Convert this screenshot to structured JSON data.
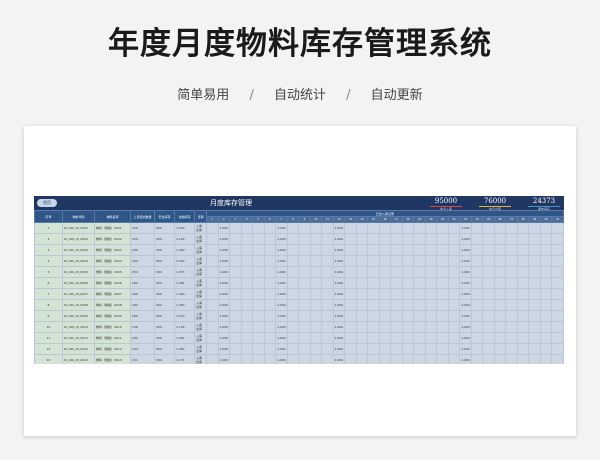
{
  "page": {
    "title": "年度月度物料库存管理系统",
    "features": [
      "简单易用",
      "自动统计",
      "自动更新"
    ],
    "separator": "/"
  },
  "sheet": {
    "home_button": "首页",
    "title": "月度库存管理",
    "stats": [
      {
        "value": "95000",
        "label": "本月入库",
        "color": "#e0443c"
      },
      {
        "value": "76000",
        "label": "本月出库",
        "color": "#e8b23a"
      },
      {
        "value": "24373",
        "label": "期末库存",
        "color": "#4a90c8"
      }
    ],
    "headers": [
      "序号",
      "物料代码",
      "物料名称",
      "上月结余数量",
      "安全库存",
      "当前库存",
      "日期"
    ],
    "daily_header": "日出入库记录",
    "io_labels": [
      "入库",
      "出库"
    ],
    "day_numbers": [
      "1",
      "2",
      "3",
      "4",
      "5",
      "6",
      "7",
      "8",
      "9",
      "10",
      "11",
      "12",
      "13",
      "14",
      "15",
      "16",
      "17",
      "18",
      "19",
      "20",
      "21",
      "22",
      "23",
      "24",
      "25",
      "26",
      "27",
      "28",
      "29",
      "30",
      "31"
    ],
    "rows": [
      {
        "no": "1",
        "code": "W_GDL_M_0001",
        "name": "物料（规格）0001",
        "prev": "150",
        "safety": "300",
        "current": "1,220"
      },
      {
        "no": "2",
        "code": "W_GDL_M_0002",
        "name": "物料（规格）0002",
        "prev": "120",
        "safety": "300",
        "current": "1,190"
      },
      {
        "no": "3",
        "code": "W_GDL_M_0003",
        "name": "物料（规格）0003",
        "prev": "190",
        "safety": "300",
        "current": "1,260"
      },
      {
        "no": "4",
        "code": "W_GDL_M_0004",
        "name": "物料（规格）0004",
        "prev": "200",
        "safety": "300",
        "current": "1,320"
      },
      {
        "no": "5",
        "code": "W_GDL_M_0005",
        "name": "物料（规格）0005",
        "prev": "254",
        "safety": "300",
        "current": "1,373"
      },
      {
        "no": "6",
        "code": "W_GDL_M_0006",
        "name": "物料（规格）0006",
        "prev": "182",
        "safety": "300",
        "current": "1,282"
      },
      {
        "no": "7",
        "code": "W_GDL_M_0007",
        "name": "物料（规格）0007",
        "prev": "180",
        "safety": "300",
        "current": "1,300"
      },
      {
        "no": "8",
        "code": "W_GDL_M_0008",
        "name": "物料（规格）0008",
        "prev": "182",
        "safety": "300",
        "current": "1,300"
      },
      {
        "no": "9",
        "code": "W_GDL_M_0009",
        "name": "物料（规格）0009",
        "prev": "180",
        "safety": "300",
        "current": "1,370"
      },
      {
        "no": "10",
        "code": "W_GDL_M_0010",
        "name": "物料（规格）0010",
        "prev": "136",
        "safety": "300",
        "current": "1,136"
      },
      {
        "no": "11",
        "code": "W_GDL_M_0011",
        "name": "物料（规格）0011",
        "prev": "192",
        "safety": "300",
        "current": "1,252"
      },
      {
        "no": "12",
        "code": "W_GDL_M_0012",
        "name": "物料（规格）0012",
        "prev": "143",
        "safety": "300",
        "current": "1,283"
      },
      {
        "no": "13",
        "code": "W_GDL_M_0013",
        "name": "物料（规格）0013",
        "prev": "151",
        "safety": "300",
        "current": "1,171"
      },
      {
        "no": "14",
        "code": "W_GDL_M_0014",
        "name": "物料（规格）0014",
        "prev": "146",
        "safety": "300",
        "current": "1,376"
      }
    ],
    "entry_value": "1,000",
    "entry_days": [
      "2",
      "7",
      "12",
      "23"
    ]
  }
}
